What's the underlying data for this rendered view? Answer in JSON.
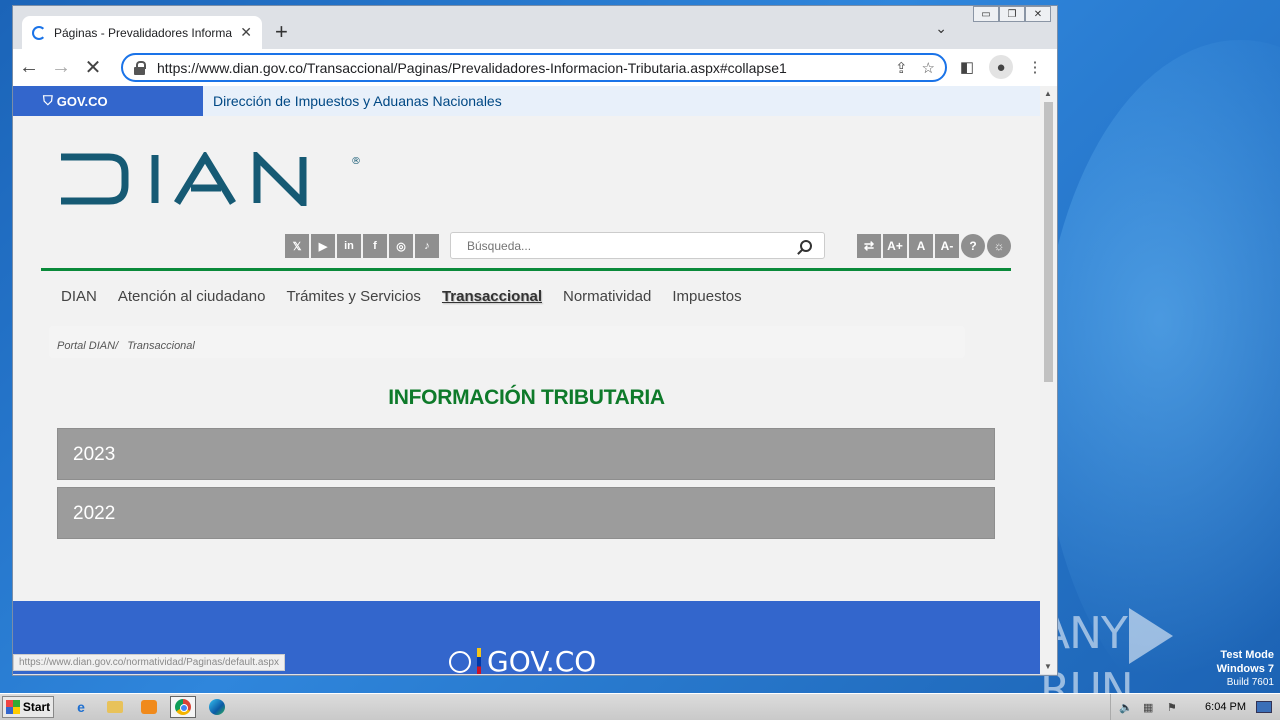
{
  "browser": {
    "tab_title": "Páginas - Prevalidadores Informacion",
    "tab_close": "✕",
    "new_tab": "+",
    "tab_dropdown": "⌄",
    "url": "https://www.dian.gov.co/Transaccional/Paginas/Prevalidadores-Informacion-Tributaria.aspx#collapse1",
    "window_controls": [
      "▭",
      "❐",
      "✕"
    ]
  },
  "page": {
    "gov_logo": "GOV.CO",
    "gov_bar_text": "Dirección de Impuestos y Aduanas Nacionales",
    "dian_logo": "DIAN",
    "social": [
      "𝕏",
      "▶",
      "in",
      "f",
      "◎",
      "♪"
    ],
    "search_placeholder": "Búsqueda...",
    "accessibility": [
      "⇄",
      "A+",
      "A",
      "A-",
      "?",
      "☼"
    ],
    "menu": [
      "DIAN",
      "Atención al ciudadano",
      "Trámites y Servicios",
      "Transaccional",
      "Normatividad",
      "Impuestos"
    ],
    "breadcrumb": [
      "Portal DIAN/",
      "Transaccional"
    ],
    "section_title": "INFORMACIÓN TRIBUTARIA",
    "accordion": [
      "2023",
      "2022"
    ],
    "footer_logo": "GOV.CO",
    "status_url": "https://www.dian.gov.co/normatividad/Paginas/default.aspx"
  },
  "desktop": {
    "watermark_left": "ANY",
    "watermark_right": "RUN",
    "test_mode": [
      "Test Mode",
      "Windows 7",
      "Build 7601"
    ]
  },
  "taskbar": {
    "start_label": "Start",
    "clock": "6:04 PM"
  },
  "colors": {
    "gov_blue": "#3366cc",
    "dian_green": "#0e7a2a",
    "accordion_grey": "#9c9c9c"
  }
}
